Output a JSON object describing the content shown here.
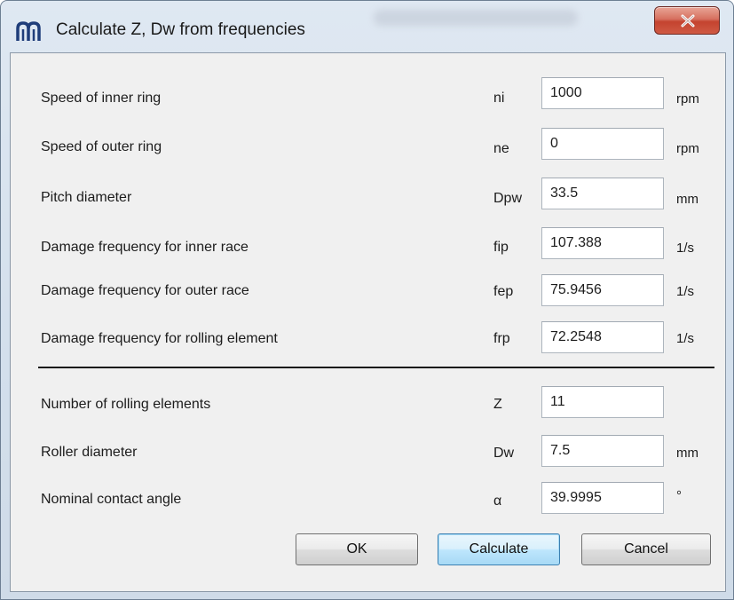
{
  "window": {
    "title": "Calculate Z, Dw from frequencies",
    "app_icon": "mesys-logo-icon",
    "close_icon": "close-icon",
    "close_button_color": "#c8432f"
  },
  "rows": [
    {
      "label": "Speed of inner ring",
      "symbol": "ni",
      "value": "1000",
      "unit": "rpm"
    },
    {
      "label": "Speed of outer ring",
      "symbol": "ne",
      "value": "0",
      "unit": "rpm"
    },
    {
      "label": "Pitch diameter",
      "symbol": "Dpw",
      "value": "33.5",
      "unit": "mm"
    },
    {
      "label": "Damage frequency for inner race",
      "symbol": "fip",
      "value": "107.388",
      "unit": "1/s"
    },
    {
      "label": "Damage frequency for outer race",
      "symbol": "fep",
      "value": "75.9456",
      "unit": "1/s"
    },
    {
      "label": "Damage frequency for rolling element",
      "symbol": "frp",
      "value": "72.2548",
      "unit": "1/s"
    },
    {
      "label": "Number of rolling elements",
      "symbol": "Z",
      "value": "11",
      "unit": ""
    },
    {
      "label": "Roller diameter",
      "symbol": "Dw",
      "value": "7.5",
      "unit": "mm"
    },
    {
      "label": "Nominal contact angle",
      "symbol": "α",
      "value": "39.9995",
      "unit": "°"
    }
  ],
  "buttons": {
    "ok": "OK",
    "calculate": "Calculate",
    "cancel": "Cancel"
  }
}
